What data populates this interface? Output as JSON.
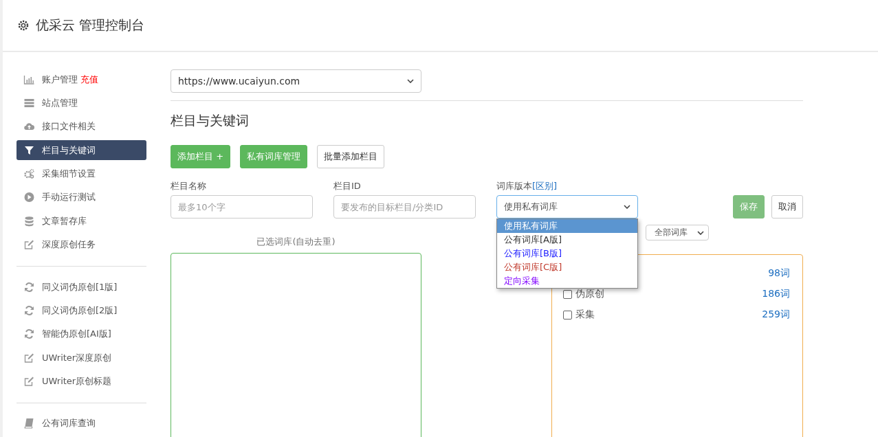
{
  "header": {
    "title": "优采云 管理控制台"
  },
  "sidebar": {
    "groups": [
      {
        "items": [
          {
            "kind": "chart",
            "label": "账户管理",
            "badge": "充值",
            "selected": false
          },
          {
            "kind": "server",
            "label": "站点管理",
            "selected": false
          },
          {
            "kind": "cloud",
            "label": "接口文件相关",
            "selected": false
          },
          {
            "kind": "filter",
            "label": "栏目与关键词",
            "selected": true
          },
          {
            "kind": "gears",
            "label": "采集细节设置",
            "selected": false
          },
          {
            "kind": "play",
            "label": "手动运行测试",
            "selected": false
          },
          {
            "kind": "database",
            "label": "文章暂存库",
            "selected": false
          },
          {
            "kind": "edit",
            "label": "深度原创任务",
            "selected": false
          }
        ]
      },
      {
        "items": [
          {
            "kind": "refresh",
            "label": "同义词伪原创[1版]",
            "selected": false
          },
          {
            "kind": "refresh",
            "label": "同义词伪原创[2版]",
            "selected": false
          },
          {
            "kind": "refresh",
            "label": "智能伪原创[AI版]",
            "selected": false
          },
          {
            "kind": "edit",
            "label": "UWriter深度原创",
            "selected": false
          },
          {
            "kind": "edit",
            "label": "UWriter原创标题",
            "selected": false
          }
        ]
      },
      {
        "items": [
          {
            "kind": "book",
            "label": "公有词库查询",
            "selected": false
          }
        ]
      }
    ]
  },
  "main": {
    "site_select": {
      "value": "https://www.ucaiyun.com"
    },
    "heading": "栏目与关键词",
    "buttons": [
      {
        "label": "添加栏目 +",
        "kind": "primary"
      },
      {
        "label": "私有词库管理",
        "kind": "primary"
      },
      {
        "label": "批量添加栏目",
        "kind": "default"
      }
    ],
    "form": {
      "name": {
        "label": "栏目名称",
        "placeholder": "最多10个字"
      },
      "id": {
        "label": "栏目ID",
        "placeholder": "要发布的目标栏目/分类ID"
      },
      "version": {
        "label": "词库版本",
        "link": "[区别]",
        "value": "使用私有词库",
        "options": [
          {
            "label": "使用私有词库",
            "selected": true
          },
          {
            "label": "公有词库[A版]",
            "selected": false
          },
          {
            "label": "公有词库[B版]",
            "selected": false,
            "color": "#1a1aff"
          },
          {
            "label": "公有词库[C版]",
            "selected": false,
            "color": "#c0392b"
          },
          {
            "label": "定向采集",
            "selected": false,
            "color": "#8000ff"
          }
        ]
      },
      "save": "保存",
      "cancel": "取消"
    },
    "selected_libraries": {
      "title": "已选词库(自动去重)"
    },
    "library_filter": {
      "value": "全部词库"
    },
    "libraries": [
      {
        "count": "98词"
      },
      {
        "label": "伪原创",
        "checked": false,
        "count": "186词"
      },
      {
        "label": "采集",
        "checked": false,
        "count": "259词"
      }
    ]
  }
}
